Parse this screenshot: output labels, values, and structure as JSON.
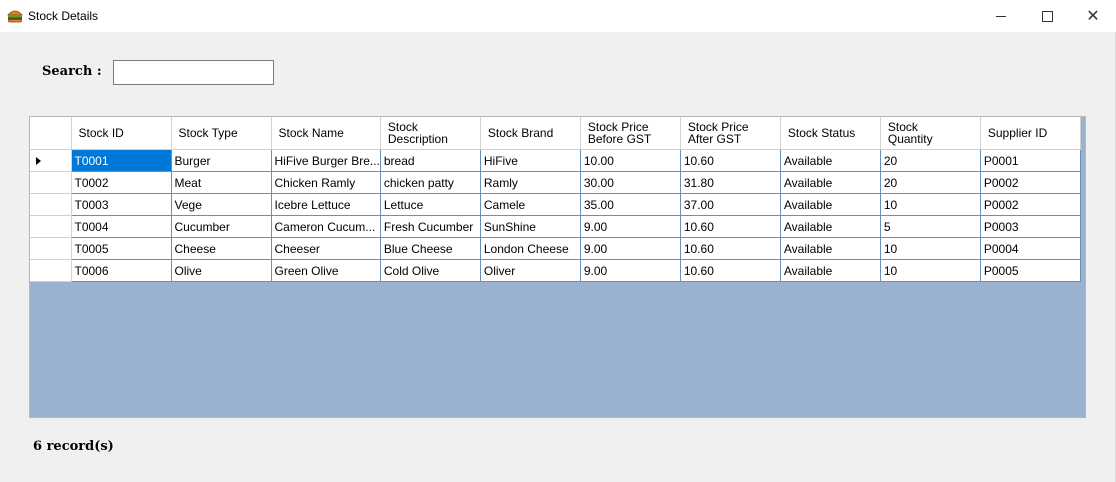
{
  "window": {
    "title": "Stock Details",
    "icon": "burger-icon",
    "controls": {
      "minimize": "minimize-icon",
      "maximize": "maximize-icon",
      "close": "close-icon"
    }
  },
  "search": {
    "label": "Search :",
    "value": ""
  },
  "grid": {
    "columns": [
      "Stock ID",
      "Stock Type",
      "Stock Name",
      "Stock\nDescription",
      "Stock Brand",
      "Stock Price\nBefore GST",
      "Stock Price\nAfter GST",
      "Stock Status",
      "Stock\nQuantity",
      "Supplier ID"
    ],
    "rows": [
      [
        "T0001",
        "Burger",
        "HiFive Burger Bre...",
        "bread",
        "HiFive",
        "10.00",
        "10.60",
        "Available",
        "20",
        "P0001"
      ],
      [
        "T0002",
        "Meat",
        "Chicken Ramly",
        "chicken patty",
        "Ramly",
        "30.00",
        "31.80",
        "Available",
        "20",
        "P0002"
      ],
      [
        "T0003",
        "Vege",
        "Icebre Lettuce",
        "Lettuce",
        "Camele",
        "35.00",
        "37.00",
        "Available",
        "10",
        "P0002"
      ],
      [
        "T0004",
        "Cucumber",
        "Cameron Cucum...",
        "Fresh Cucumber",
        "SunShine",
        "9.00",
        "10.60",
        "Available",
        "5",
        "P0003"
      ],
      [
        "T0005",
        "Cheese",
        "Cheeser",
        "Blue Cheese",
        "London Cheese",
        "9.00",
        "10.60",
        "Available",
        "10",
        "P0004"
      ],
      [
        "T0006",
        "Olive",
        "Green Olive",
        "Cold Olive",
        "Oliver",
        "9.00",
        "10.60",
        "Available",
        "10",
        "P0005"
      ]
    ],
    "selected_cell": "T0001",
    "background_color": "#9ab2d0",
    "selection_color": "#0078d7"
  },
  "footer": {
    "record_count": "6 record(s)"
  }
}
